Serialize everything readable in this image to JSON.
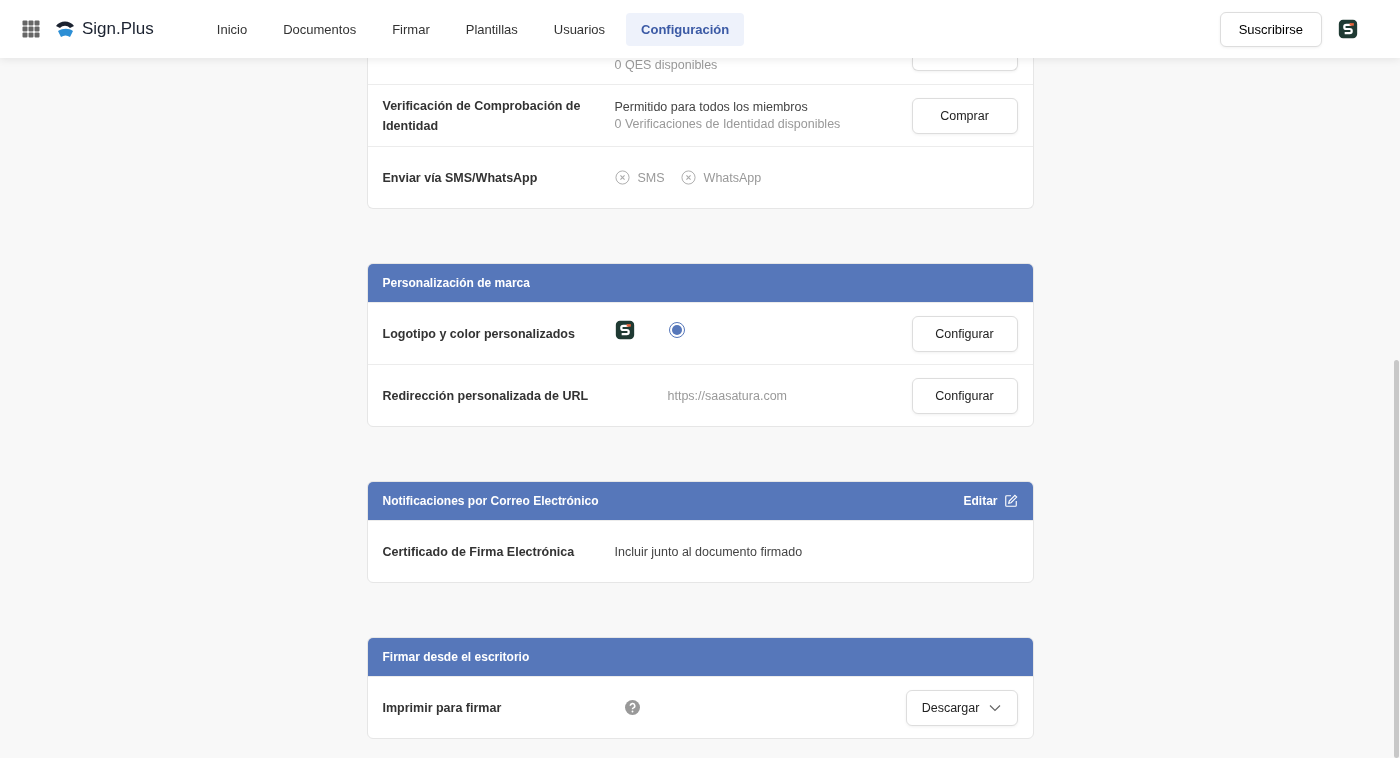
{
  "header": {
    "logo": "Sign.Plus",
    "nav": [
      {
        "label": "Inicio",
        "selected": false
      },
      {
        "label": "Documentos",
        "selected": false
      },
      {
        "label": "Firmar",
        "selected": false
      },
      {
        "label": "Plantillas",
        "selected": false
      },
      {
        "label": "Usuarios",
        "selected": false
      },
      {
        "label": "Configuración",
        "selected": true
      }
    ],
    "subscribe": "Suscribirse"
  },
  "sections": [
    {
      "rows": [
        {
          "kind": "cut",
          "note": "0 QES disponibles"
        },
        {
          "kind": "buy",
          "label": "Verificación de Comprobación de Identidad",
          "value": "Permitido para todos los miembros",
          "note": "0 Verificaciones de Identidad disponibles",
          "button": "Comprar"
        },
        {
          "kind": "options",
          "label": "Enviar vía SMS/WhatsApp",
          "options": [
            {
              "label": "SMS",
              "checked": false
            },
            {
              "label": "WhatsApp",
              "checked": false
            }
          ]
        }
      ]
    },
    {
      "title": "Personalización de marca",
      "rows": [
        {
          "kind": "logo",
          "label": "Logotipo y color personalizados",
          "selected": true,
          "button": "Configurar"
        },
        {
          "kind": "url",
          "label": "Redirección personalizada de URL",
          "note": "https://saasatura.com",
          "button": "Configurar"
        }
      ]
    },
    {
      "title": "Notificaciones por Correo Electrónico",
      "edit": "Editar",
      "rows": [
        {
          "kind": "text",
          "label": "Certificado de Firma Electrónica",
          "value": "Incluir junto al documento firmado"
        }
      ]
    },
    {
      "title": "Firmar desde el escritorio",
      "rows": [
        {
          "kind": "download",
          "label": "Imprimir para firmar",
          "button": "Descargar"
        }
      ]
    }
  ]
}
